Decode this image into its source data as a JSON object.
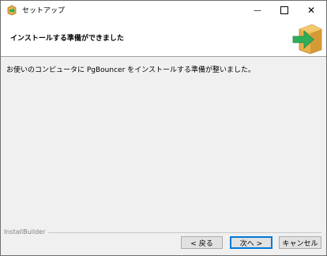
{
  "window": {
    "title": "セットアップ"
  },
  "header": {
    "title": "インストールする準備ができました"
  },
  "body": {
    "message": "お使いのコンピュータに PgBouncer をインストールする準備が整いました。"
  },
  "footer": {
    "brand": "InstallBuilder",
    "back_label": "< 戻る",
    "next_label": "次へ >",
    "cancel_label": "キャンセル"
  },
  "titlebar_controls": {
    "minimize": "—",
    "close": "✕"
  },
  "colors": {
    "box": "#e8b04a",
    "arrow": "#2fae5a",
    "focus": "#0078d7"
  },
  "icons": [
    "installer-box-icon",
    "install-arrow-icon",
    "app-icon"
  ]
}
